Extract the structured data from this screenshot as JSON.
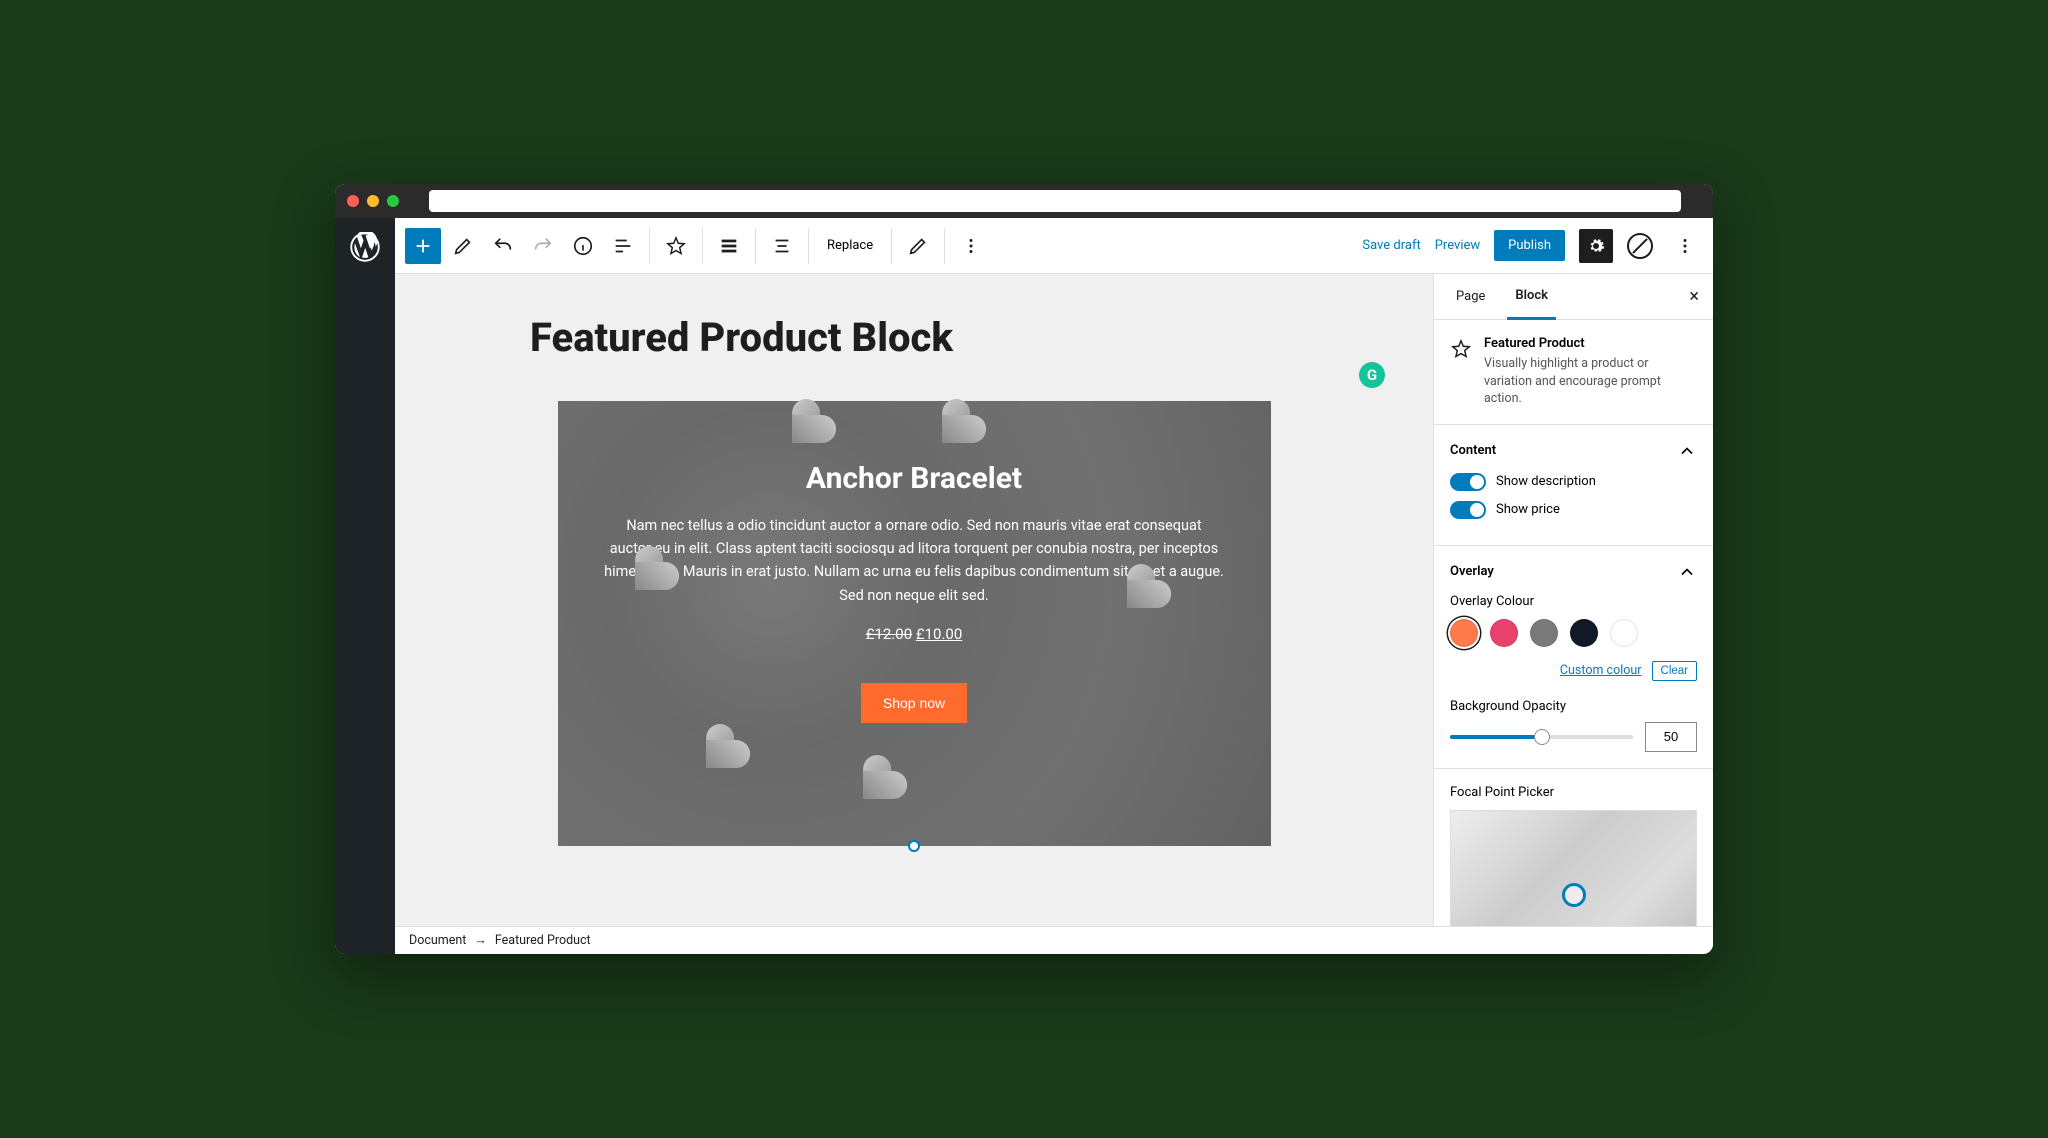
{
  "toolbar": {
    "replace": "Replace",
    "save_draft": "Save draft",
    "preview": "Preview",
    "publish": "Publish"
  },
  "page": {
    "title": "Featured Product Block"
  },
  "featured": {
    "product_name": "Anchor Bracelet",
    "description": "Nam nec tellus a odio tincidunt auctor a ornare odio. Sed non mauris vitae erat consequat auctor eu in elit. Class aptent taciti sociosqu ad litora torquent per conubia nostra, per inceptos himenaeos. Mauris in erat justo. Nullam ac urna eu felis dapibus condimentum sit amet a augue. Sed non neque elit sed.",
    "price_old": "£12.00",
    "price_new": "£10.00",
    "cta": "Shop now"
  },
  "breadcrumb": {
    "root": "Document",
    "current": "Featured Product"
  },
  "sidebar": {
    "tabs": {
      "page": "Page",
      "block": "Block"
    },
    "block_info": {
      "title": "Featured Product",
      "desc": "Visually highlight a product or variation and encourage prompt action."
    },
    "content": {
      "heading": "Content",
      "show_description": "Show description",
      "show_price": "Show price"
    },
    "overlay": {
      "heading": "Overlay",
      "colour_label": "Overlay Colour",
      "swatches": [
        "#ff7a4d",
        "#e8416c",
        "#7a7a7a",
        "#111827",
        "#ffffff"
      ],
      "custom": "Custom colour",
      "clear": "Clear",
      "opacity_label": "Background Opacity",
      "opacity_value": "50"
    },
    "focal": {
      "heading": "Focal Point Picker"
    }
  }
}
